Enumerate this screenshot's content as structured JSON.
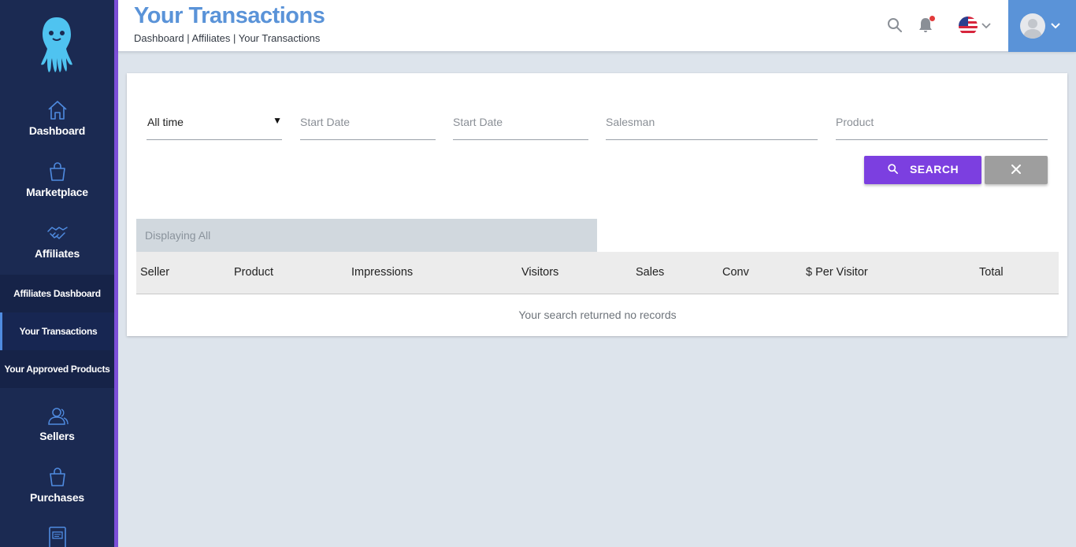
{
  "sidebar": {
    "items": [
      {
        "label": "Dashboard",
        "icon": "home-icon"
      },
      {
        "label": "Marketplace",
        "icon": "shopping-bag-icon"
      },
      {
        "label": "Affiliates",
        "icon": "handshake-icon"
      },
      {
        "label": "Sellers",
        "icon": "users-icon"
      },
      {
        "label": "Purchases",
        "icon": "shopping-bag-icon"
      },
      {
        "label": "",
        "icon": "document-icon"
      }
    ],
    "submenu": [
      {
        "label": "Affiliates Dashboard",
        "active": false
      },
      {
        "label": "Your Transactions",
        "active": true
      },
      {
        "label": "Your Approved Products",
        "active": false
      }
    ]
  },
  "header": {
    "title": "Your Transactions",
    "breadcrumb": "Dashboard | Affiliates | Your Transactions"
  },
  "filters": {
    "period_value": "All time",
    "start_date_placeholder": "Start Date",
    "end_date_placeholder": "Start Date",
    "salesman_placeholder": "Salesman",
    "product_placeholder": "Product",
    "search_label": "SEARCH"
  },
  "table": {
    "displaying_label": "Displaying All",
    "columns": [
      "Seller",
      "Product",
      "Impressions",
      "Visitors",
      "Sales",
      "Conv",
      "$ Per Visitor",
      "Total"
    ],
    "empty_message": "Your search returned no records"
  },
  "colors": {
    "sidebar_bg": "#1b2a52",
    "accent_purple": "#7c3fe0",
    "brand_blue": "#5a93d8",
    "page_bg": "#dde4ec"
  }
}
